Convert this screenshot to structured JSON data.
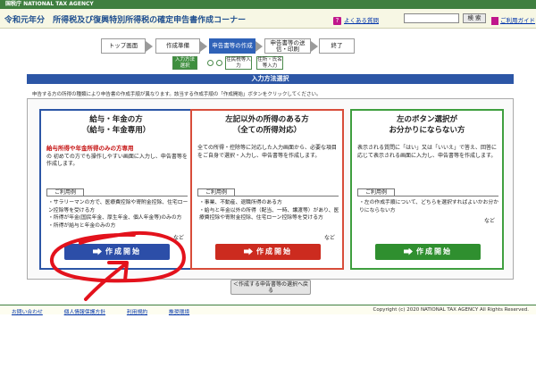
{
  "header": {
    "agency": "国税庁 NATIONAL TAX AGENCY",
    "title_year": "令和元年分",
    "title_main": "所得税及び復興特別所得税の確定申告書作成コーナー",
    "help_link": "よくある質問",
    "search_button": "検 索",
    "manual_link": "ご利用ガイド"
  },
  "steps": [
    {
      "label": "トップ画面"
    },
    {
      "label": "作成準備"
    },
    {
      "label": "申告書等の作成"
    },
    {
      "label": "申告書等の送信・印刷"
    },
    {
      "label": "終了"
    }
  ],
  "substeps": [
    {
      "label": "入力方法選択"
    },
    {
      "label": "住民税等入力"
    },
    {
      "label": "住所・氏名等入力"
    }
  ],
  "section_heading": "入力方法選択",
  "instruction": "申告する方の所得の種類により申告書の作成手順が異なります。該当する作成手順の「作成開始」ボタンをクリックしてください。",
  "cards": [
    {
      "title_line1": "給与・年金の方",
      "title_line2": "（給与・年金専用）",
      "desc_red": "給与所得や年金所得のみの方専用",
      "desc": "の 初めての方でも操作しやすい画面に入力し、申告書等を作成します。",
      "usage_label": "ご利用例",
      "examples": [
        "・サラリーマンの方で、医療費控除や寄附金控除、住宅ローン控除等を受ける方",
        "・所得が年金(国民年金、厚生年金、個人年金等)のみの方",
        "・所得が給与と年金のみの方"
      ],
      "nado": "など",
      "button": "作成開始"
    },
    {
      "title_line1": "左記以外の所得のある方",
      "title_line2": "（全ての所得対応）",
      "desc_red": "",
      "desc": "全ての所得・控除等に対応した入力画面から、必要な項目をご自身で選択・入力し、申告書等を作成します。",
      "usage_label": "ご利用例",
      "examples": [
        "・事業、不動産、退職所得のある方",
        "・給与と年金以外の所得（配当、一時、譲渡等）があり、医療費控除や寄附金控除、住宅ローン控除等を受ける方"
      ],
      "nado": "など",
      "button": "作成開始"
    },
    {
      "title_line1": "左のボタン選択が",
      "title_line2": "お分かりにならない方",
      "desc_red": "",
      "desc": "表示される質問に「はい」又は「いいえ」で答え、回答に応じて表示される画面に入力し、申告書等を作成します。",
      "usage_label": "ご利用例",
      "examples": [
        "・左の作成手順について、どちらを選択すればよいかお分かりにならない方"
      ],
      "nado": "など",
      "button": "作成開始"
    }
  ],
  "back_button": "＜作成する申告書等の選択へ戻る",
  "footer": {
    "links": [
      "お問い合わせ",
      "個人情報保護方針",
      "利用規約",
      "推奨環境"
    ],
    "copyright": "Copyright (c) 2020 NATIONAL TAX AGENCY All Rights Reserved."
  }
}
